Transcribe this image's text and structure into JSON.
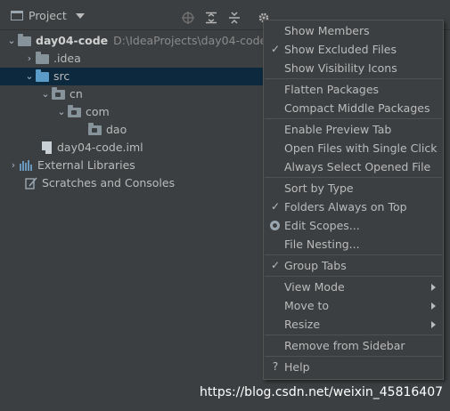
{
  "toolbar": {
    "title": "Project",
    "icons": [
      "target-icon",
      "expand-all-icon",
      "collapse-all-icon",
      "gear-icon",
      "minimize-icon"
    ]
  },
  "tree": [
    {
      "label": "day04-code",
      "path": "D:\\IdeaProjects\\day04-code",
      "icon": "module-folder-icon",
      "expanded": true
    },
    {
      "label": ".idea",
      "icon": "folder-icon",
      "expanded": false
    },
    {
      "label": "src",
      "icon": "source-folder-icon",
      "expanded": true,
      "selected": true
    },
    {
      "label": "cn",
      "icon": "package-icon",
      "expanded": true
    },
    {
      "label": "com",
      "icon": "package-icon",
      "expanded": true
    },
    {
      "label": "dao",
      "icon": "package-icon"
    },
    {
      "label": "day04-code.iml",
      "icon": "iml-file-icon"
    },
    {
      "label": "External Libraries",
      "icon": "libraries-icon",
      "expanded": false
    },
    {
      "label": "Scratches and Consoles",
      "icon": "scratches-icon"
    }
  ],
  "menu": {
    "items": [
      {
        "label": "Show Members",
        "checked": false
      },
      {
        "label": "Show Excluded Files",
        "checked": true
      },
      {
        "label": "Show Visibility Icons",
        "checked": false
      },
      {
        "label": "Flatten Packages",
        "checked": false
      },
      {
        "label": "Compact Middle Packages",
        "checked": false
      },
      {
        "label": "Enable Preview Tab",
        "checked": false
      },
      {
        "label": "Open Files with Single Click",
        "checked": false
      },
      {
        "label": "Always Select Opened File",
        "checked": false
      },
      {
        "label": "Sort by Type",
        "checked": false
      },
      {
        "label": "Folders Always on Top",
        "checked": true
      },
      {
        "label": "Edit Scopes...",
        "radio": true
      },
      {
        "label": "File Nesting...",
        "checked": false
      },
      {
        "label": "Group Tabs",
        "checked": true
      },
      {
        "label": "View Mode",
        "submenu": true
      },
      {
        "label": "Move to",
        "submenu": true
      },
      {
        "label": "Resize",
        "submenu": true
      },
      {
        "label": "Remove from Sidebar",
        "checked": false
      },
      {
        "label": "Help",
        "icon": "help-icon"
      }
    ],
    "check_glyph": "✓",
    "help_glyph": "?"
  },
  "watermark": "https://blog.csdn.net/weixin_45816407",
  "colors": {
    "selection": "#0d293e",
    "panel": "#3c3f41",
    "text": "#bbbbbb"
  }
}
